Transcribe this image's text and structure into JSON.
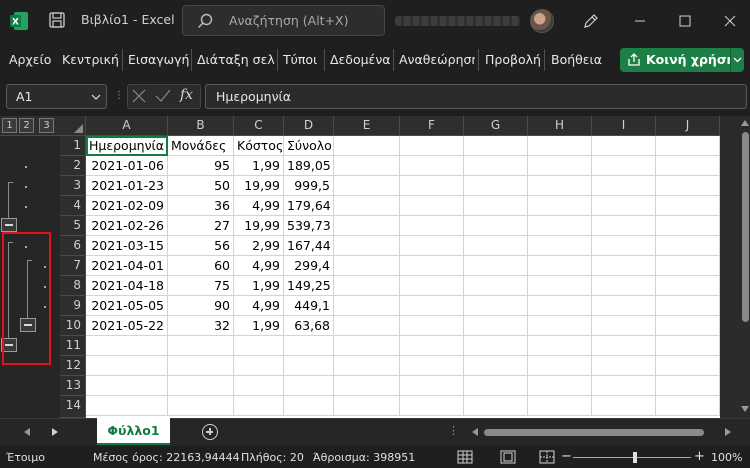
{
  "titlebar": {
    "title": "Βιβλίο1  -  Excel",
    "search_placeholder": "Αναζήτηση (Alt+X)"
  },
  "ribbon": {
    "tabs": [
      "Αρχείο",
      "Κεντρική",
      "Εισαγωγή",
      "Διάταξη σελίδ",
      "Τύποι",
      "Δεδομένα",
      "Αναθεώρηση",
      "Προβολή",
      "Βοήθεια"
    ],
    "share_label": "Κοινή χρήση"
  },
  "formula_bar": {
    "name_box": "A1",
    "formula": "Ημερομηνία"
  },
  "outline_levels": [
    "1",
    "2",
    "3"
  ],
  "columns": [
    "A",
    "B",
    "C",
    "D",
    "E",
    "F",
    "G",
    "H",
    "I",
    "J"
  ],
  "rows": [
    "1",
    "2",
    "3",
    "4",
    "5",
    "6",
    "7",
    "8",
    "9",
    "10",
    "11",
    "12",
    "13",
    "14"
  ],
  "table": {
    "header": [
      "Ημερομηνία",
      "Μονάδες",
      "Κόστος",
      "Σύνολο"
    ],
    "data": [
      [
        "2021-01-06",
        "95",
        "1,99",
        "189,05"
      ],
      [
        "2021-01-23",
        "50",
        "19,99",
        "999,5"
      ],
      [
        "2021-02-09",
        "36",
        "4,99",
        "179,64"
      ],
      [
        "2021-02-26",
        "27",
        "19,99",
        "539,73"
      ],
      [
        "2021-03-15",
        "56",
        "2,99",
        "167,44"
      ],
      [
        "2021-04-01",
        "60",
        "4,99",
        "299,4"
      ],
      [
        "2021-04-18",
        "75",
        "1,99",
        "149,25"
      ],
      [
        "2021-05-05",
        "90",
        "4,99",
        "449,1"
      ],
      [
        "2021-05-22",
        "32",
        "1,99",
        "63,68"
      ]
    ]
  },
  "sheet_tab": "Φύλλο1",
  "status": {
    "ready": "Έτοιμο",
    "average": "Μέσος όρος: 22163,94444",
    "count": "Πλήθος: 20",
    "sum": "Άθροισμα: 398951",
    "zoom": "100%"
  },
  "colors": {
    "excel_green": "#107c41",
    "share_green": "#1c7f46",
    "highlight_red": "#e0151b"
  }
}
